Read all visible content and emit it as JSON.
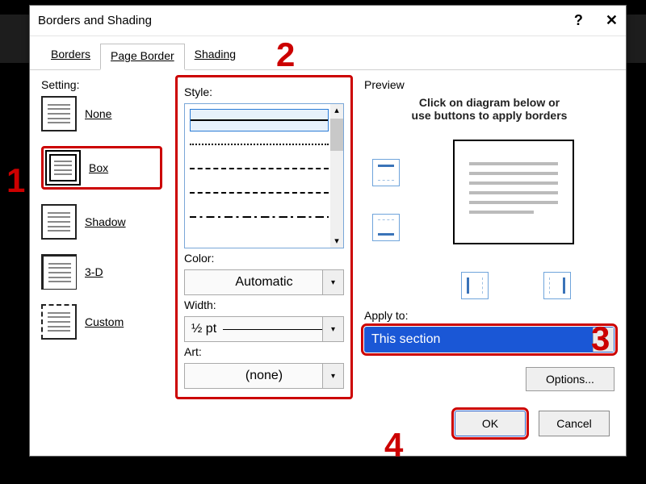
{
  "title": "Borders and Shading",
  "winbtns": {
    "help": "?",
    "close": "✕"
  },
  "tabs": [
    "Borders",
    "Page Border",
    "Shading"
  ],
  "labels": {
    "setting": "Setting:",
    "style": "Style:",
    "color": "Color:",
    "width": "Width:",
    "art": "Art:",
    "preview": "Preview",
    "apply_to": "Apply to:"
  },
  "settings": [
    "None",
    "Box",
    "Shadow",
    "3-D",
    "Custom"
  ],
  "color": "Automatic",
  "width": "½ pt",
  "art": "(none)",
  "preview_hint": [
    "Click on diagram below or",
    "use buttons to apply borders"
  ],
  "apply_to": "This section",
  "buttons": {
    "options": "Options...",
    "ok": "OK",
    "cancel": "Cancel"
  },
  "annotations": [
    "1",
    "2",
    "3",
    "4"
  ]
}
